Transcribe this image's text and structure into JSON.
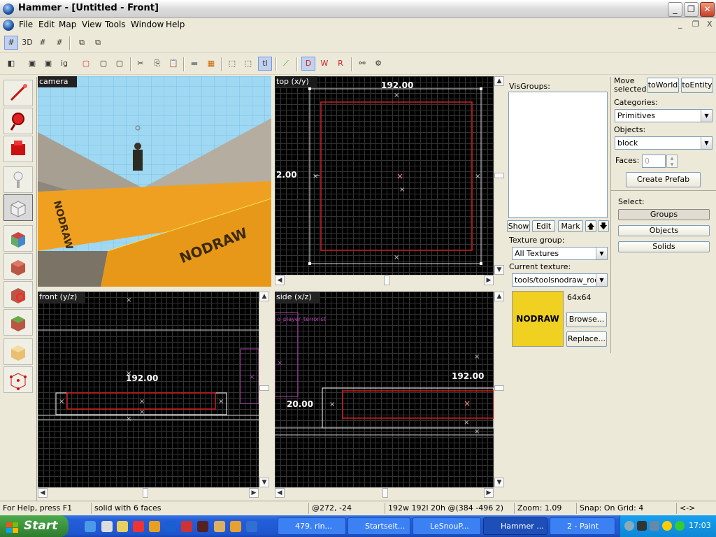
{
  "window": {
    "title": "Hammer - [Untitled - Front]",
    "btn_min": "_",
    "btn_max": "❐",
    "btn_close": "✕"
  },
  "menu": [
    "File",
    "Edit",
    "Map",
    "View",
    "Tools",
    "Window",
    "Help"
  ],
  "mdi_controls": [
    "_",
    "❐",
    "X"
  ],
  "viewports": {
    "camera": {
      "label": "camera",
      "wall_text": "NODRAW"
    },
    "top": {
      "label": "top (x/y)",
      "dim_width": "192.00",
      "dim_height": "2.00"
    },
    "front": {
      "label": "front (y/z)",
      "dim_width": "192.00"
    },
    "side": {
      "label": "side (x/z)",
      "dim_width": "192.00",
      "dim_height": "20.00",
      "entity_label": "o_player_terrorist"
    }
  },
  "right_panel": {
    "visgroups_label": "VisGroups:",
    "show": "Show",
    "edit": "Edit",
    "mark": "Mark",
    "up": "🡅",
    "down": "🡇",
    "texture_group_label": "Texture group:",
    "texture_group_value": "All Textures",
    "current_texture_label": "Current texture:",
    "current_texture_value": "tools/toolsnodraw_roof",
    "texture_preview_text": "NODRAW",
    "texture_size": "64x64",
    "browse": "Browse...",
    "replace": "Replace...",
    "move_selected_label": "Move selected:",
    "to_world": "toWorld",
    "to_entity": "toEntity",
    "categories_label": "Categories:",
    "categories_value": "Primitives",
    "objects_label": "Objects:",
    "objects_value": "block",
    "faces_label": "Faces:",
    "faces_value": "0",
    "create_prefab": "Create Prefab",
    "select_label": "Select:",
    "groups": "Groups",
    "objects_btn": "Objects",
    "solids": "Solids"
  },
  "status": {
    "help": "For Help, press F1",
    "selection": "solid with 6 faces",
    "coords": "@272, -24",
    "size": "192w 192l 20h @(384 -496 2)",
    "zoom": "Zoom: 1.09",
    "snap": "Snap: On Grid: 4",
    "arrows": "<->"
  },
  "taskbar": {
    "start": "Start",
    "items": [
      "479. rin...",
      "Startseit...",
      "LeSnouP...",
      "Hammer ...",
      "2 - Paint"
    ],
    "clock": "17:03"
  },
  "colors": {
    "selection_red": "#cc1f1f",
    "nodraw_orange": "#f0a020",
    "nodraw_yellow": "#f0d020",
    "entity_magenta": "#b040b0",
    "xp_blue": "#245edb"
  }
}
